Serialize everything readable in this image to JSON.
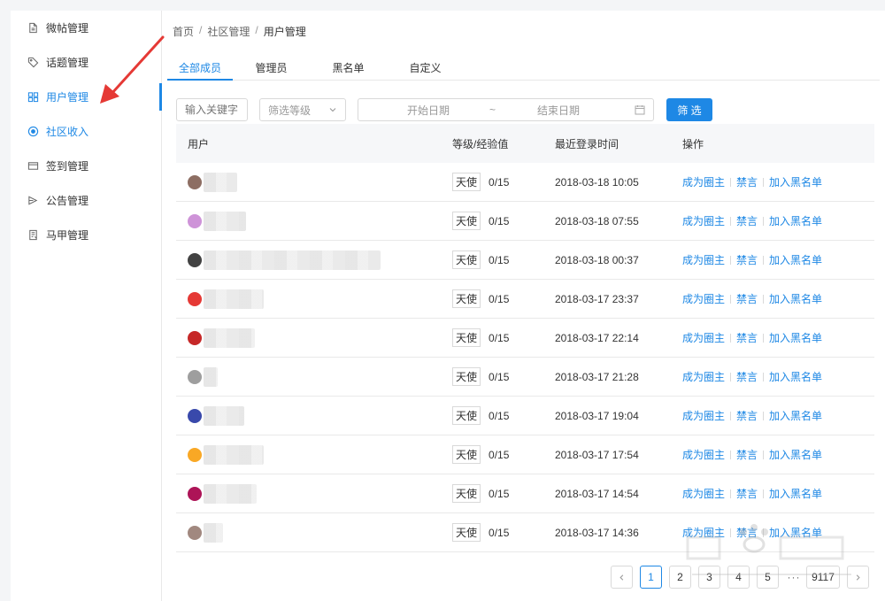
{
  "sidebar": {
    "items": [
      {
        "label": "微帖管理",
        "icon": "document-icon"
      },
      {
        "label": "话题管理",
        "icon": "tag-icon"
      },
      {
        "label": "用户管理",
        "icon": "users-icon",
        "active": true
      },
      {
        "label": "社区收入",
        "icon": "coin-icon"
      },
      {
        "label": "签到管理",
        "icon": "card-icon"
      },
      {
        "label": "公告管理",
        "icon": "announcement-icon"
      },
      {
        "label": "马甲管理",
        "icon": "vest-icon"
      }
    ]
  },
  "breadcrumb": {
    "home": "首页",
    "sep": "/",
    "section": "社区管理",
    "current": "用户管理"
  },
  "tabs": [
    {
      "label": "全部成员",
      "active": true
    },
    {
      "label": "管理员"
    },
    {
      "label": "黑名单"
    },
    {
      "label": "自定义"
    }
  ],
  "filters": {
    "keyword_placeholder": "输入关键字",
    "level_placeholder": "筛选等级",
    "start_date": "开始日期",
    "tilde": "~",
    "end_date": "结束日期",
    "submit_label": "筛 选"
  },
  "table": {
    "headers": {
      "user": "用户",
      "level": "等级/经验值",
      "time": "最近登录时间",
      "ops": "操作"
    },
    "ops": {
      "promote": "成为圈主",
      "mute": "禁言",
      "blacklist": "加入黑名单"
    },
    "rows": [
      {
        "level": "天使",
        "exp": "0/15",
        "time": "2018-03-18 10:05"
      },
      {
        "level": "天使",
        "exp": "0/15",
        "time": "2018-03-18 07:55"
      },
      {
        "level": "天使",
        "exp": "0/15",
        "time": "2018-03-18 00:37"
      },
      {
        "level": "天使",
        "exp": "0/15",
        "time": "2018-03-17 23:37"
      },
      {
        "level": "天使",
        "exp": "0/15",
        "time": "2018-03-17 22:14"
      },
      {
        "level": "天使",
        "exp": "0/15",
        "time": "2018-03-17 21:28"
      },
      {
        "level": "天使",
        "exp": "0/15",
        "time": "2018-03-17 19:04"
      },
      {
        "level": "天使",
        "exp": "0/15",
        "time": "2018-03-17 17:54"
      },
      {
        "level": "天使",
        "exp": "0/15",
        "time": "2018-03-17 14:54"
      },
      {
        "level": "天使",
        "exp": "0/15",
        "time": "2018-03-17 14:36"
      }
    ]
  },
  "pagination": {
    "pages": [
      "1",
      "2",
      "3",
      "4",
      "5"
    ],
    "current": "1",
    "ellipsis": "···",
    "last": "9117"
  },
  "colors": {
    "accent": "#1e88e5",
    "annotation": "#e53935"
  }
}
